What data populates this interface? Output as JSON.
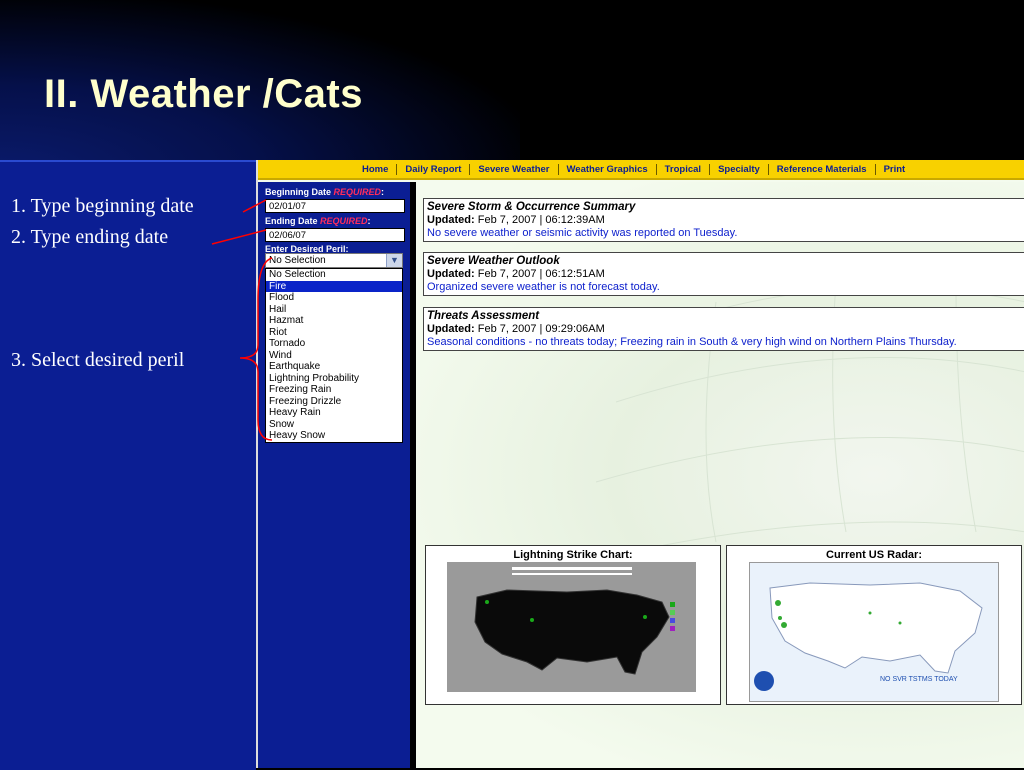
{
  "slide": {
    "title": "II. Weather /Cats",
    "instructions": [
      "1. Type beginning date",
      "2. Type ending date",
      "3. Select desired peril"
    ]
  },
  "nav": {
    "items": [
      "Home",
      "Daily Report",
      "Severe Weather",
      "Weather Graphics",
      "Tropical",
      "Specialty",
      "Reference Materials",
      "Print"
    ]
  },
  "form": {
    "begin_label": "Beginning Date",
    "required": "REQUIRED",
    "colon": ":",
    "begin_value": "02/01/07",
    "end_label": "Ending Date",
    "end_value": "02/06/07",
    "peril_label": "Enter Desired Peril:",
    "peril_selected": "No Selection",
    "peril_options": [
      "No Selection",
      "Fire",
      "Flood",
      "Hail",
      "Hazmat",
      "Riot",
      "Tornado",
      "Wind",
      "Earthquake",
      "Lightning Probability",
      "Freezing Rain",
      "Freezing Drizzle",
      "Heavy Rain",
      "Snow",
      "Heavy Snow"
    ],
    "highlighted_option": "Fire"
  },
  "summaries": [
    {
      "title": "Severe Storm & Occurrence Summary",
      "updated_label": "Updated:",
      "updated_value": "Feb 7, 2007 | 06:12:39AM",
      "message": "No severe weather or seismic activity was reported on Tuesday."
    },
    {
      "title": "Severe Weather Outlook",
      "updated_label": "Updated:",
      "updated_value": "Feb 7, 2007 | 06:12:51AM",
      "message": "Organized severe weather is not forecast today."
    },
    {
      "title": "Threats Assessment",
      "updated_label": "Updated:",
      "updated_value": "Feb 7, 2007 | 09:29:06AM",
      "message": "Seasonal conditions - no threats today; Freezing rain in South & very high wind on Northern Plains Thursday."
    }
  ],
  "cards": {
    "lightning_title": "Lightning Strike Chart:",
    "radar_title": "Current US Radar:"
  },
  "colors": {
    "nav_bg": "#f8d100",
    "form_bg": "#0b1e93",
    "required": "#ff2d5b",
    "message": "#0b1ecc",
    "title": "#ffffcc"
  }
}
